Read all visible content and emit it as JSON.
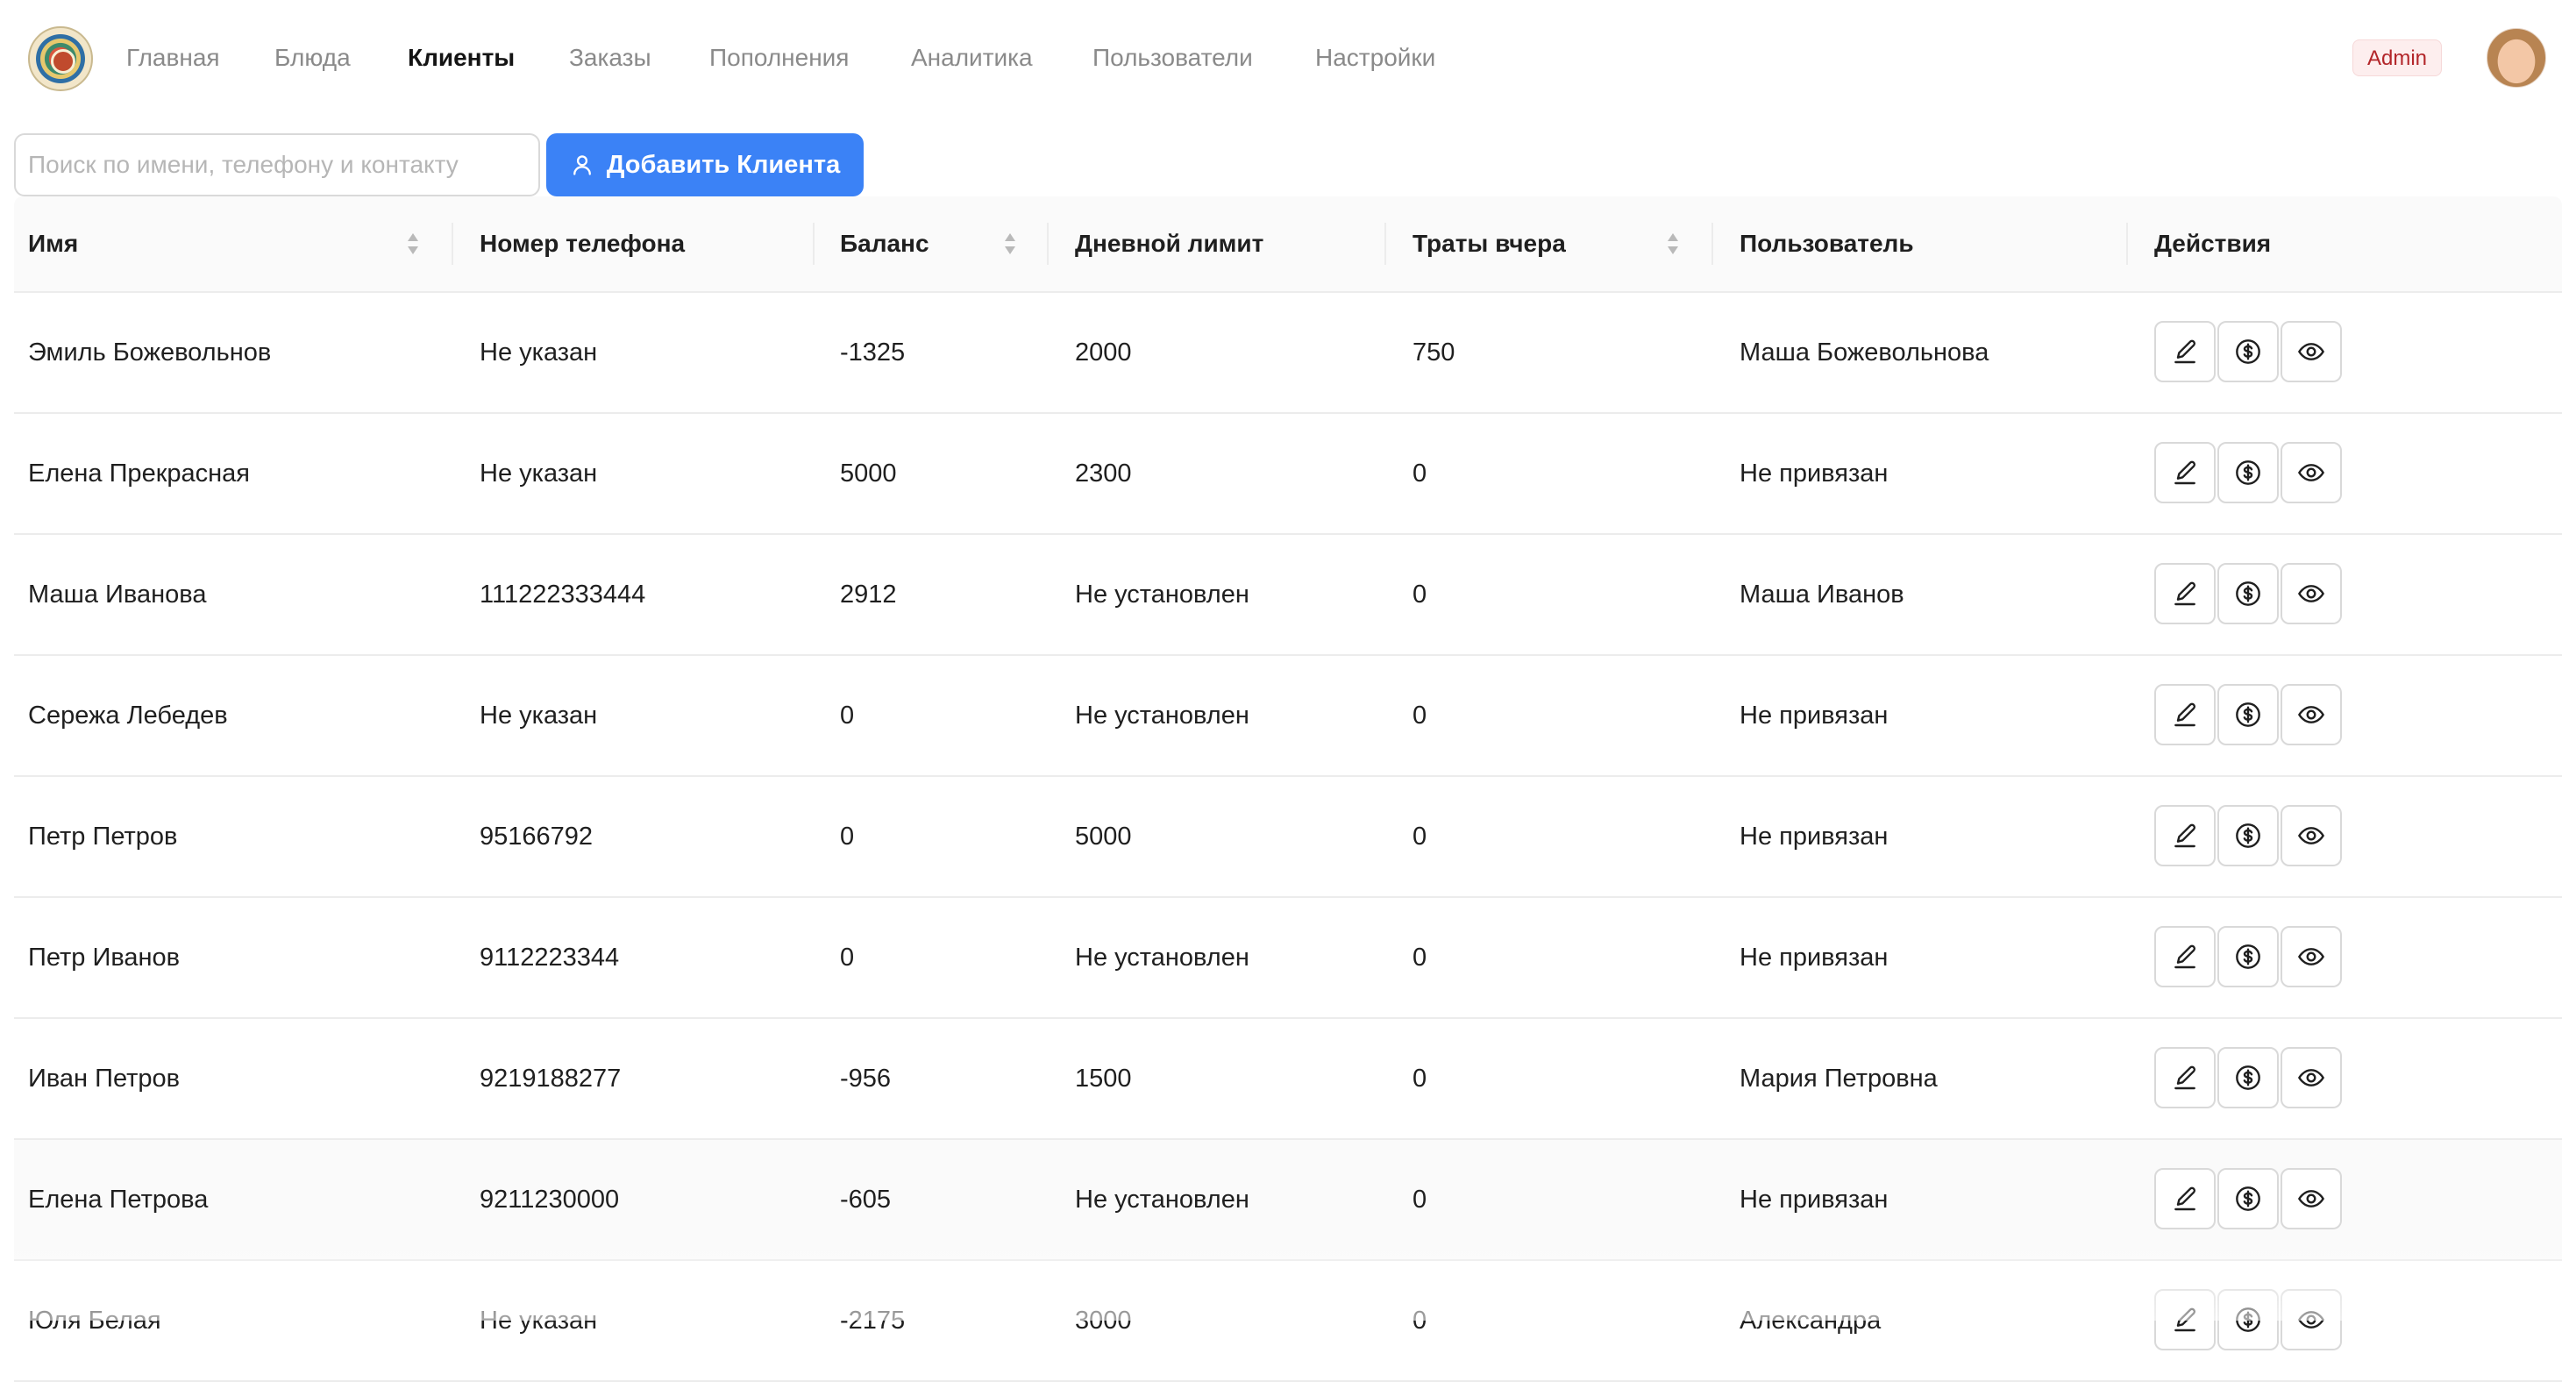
{
  "nav": {
    "items": [
      {
        "label": "Главная",
        "active": false
      },
      {
        "label": "Блюда",
        "active": false
      },
      {
        "label": "Клиенты",
        "active": true
      },
      {
        "label": "Заказы",
        "active": false
      },
      {
        "label": "Пополнения",
        "active": false
      },
      {
        "label": "Аналитика",
        "active": false
      },
      {
        "label": "Пользователи",
        "active": false
      },
      {
        "label": "Настройки",
        "active": false
      }
    ],
    "role_badge": "Admin"
  },
  "toolbar": {
    "search_placeholder": "Поиск по имени, телефону и контакту",
    "add_button_label": "Добавить Клиента"
  },
  "table": {
    "columns": [
      {
        "label": "Имя",
        "sortable": true
      },
      {
        "label": "Номер телефона",
        "sortable": false
      },
      {
        "label": "Баланс",
        "sortable": true
      },
      {
        "label": "Дневной лимит",
        "sortable": false
      },
      {
        "label": "Траты вчера",
        "sortable": true
      },
      {
        "label": "Пользователь",
        "sortable": false
      },
      {
        "label": "Действия",
        "sortable": false
      }
    ],
    "rows": [
      {
        "name": "Эмиль Божевольнов",
        "phone": "Не указан",
        "balance": "-1325",
        "limit": "2000",
        "spent": "750",
        "user": "Маша Божевольнова"
      },
      {
        "name": "Елена Прекрасная",
        "phone": "Не указан",
        "balance": "5000",
        "limit": "2300",
        "spent": "0",
        "user": "Не привязан"
      },
      {
        "name": "Маша Иванова",
        "phone": "111222333444",
        "balance": "2912",
        "limit": "Не установлен",
        "spent": "0",
        "user": "Маша Иванов"
      },
      {
        "name": "Сережа Лебедев",
        "phone": "Не указан",
        "balance": "0",
        "limit": "Не установлен",
        "spent": "0",
        "user": "Не привязан"
      },
      {
        "name": "Петр Петров",
        "phone": "95166792",
        "balance": "0",
        "limit": "5000",
        "spent": "0",
        "user": "Не привязан"
      },
      {
        "name": "Петр Иванов",
        "phone": "9112223344",
        "balance": "0",
        "limit": "Не установлен",
        "spent": "0",
        "user": "Не привязан"
      },
      {
        "name": "Иван Петров",
        "phone": "9219188277",
        "balance": "-956",
        "limit": "1500",
        "spent": "0",
        "user": "Мария Петровна"
      },
      {
        "name": "Елена Петрова",
        "phone": "9211230000",
        "balance": "-605",
        "limit": "Не установлен",
        "spent": "0",
        "user": "Не привязан"
      },
      {
        "name": "Юля Белая",
        "phone": "Не указан",
        "balance": "-2175",
        "limit": "3000",
        "spent": "0",
        "user": "Александра"
      }
    ],
    "actions": [
      "edit-icon",
      "dollar-icon",
      "eye-icon"
    ]
  },
  "colors": {
    "primary": "#3b82f6",
    "admin_badge_text": "#b3262a",
    "admin_badge_bg": "#fdeeee",
    "nav_inactive": "#8a8a8a"
  }
}
